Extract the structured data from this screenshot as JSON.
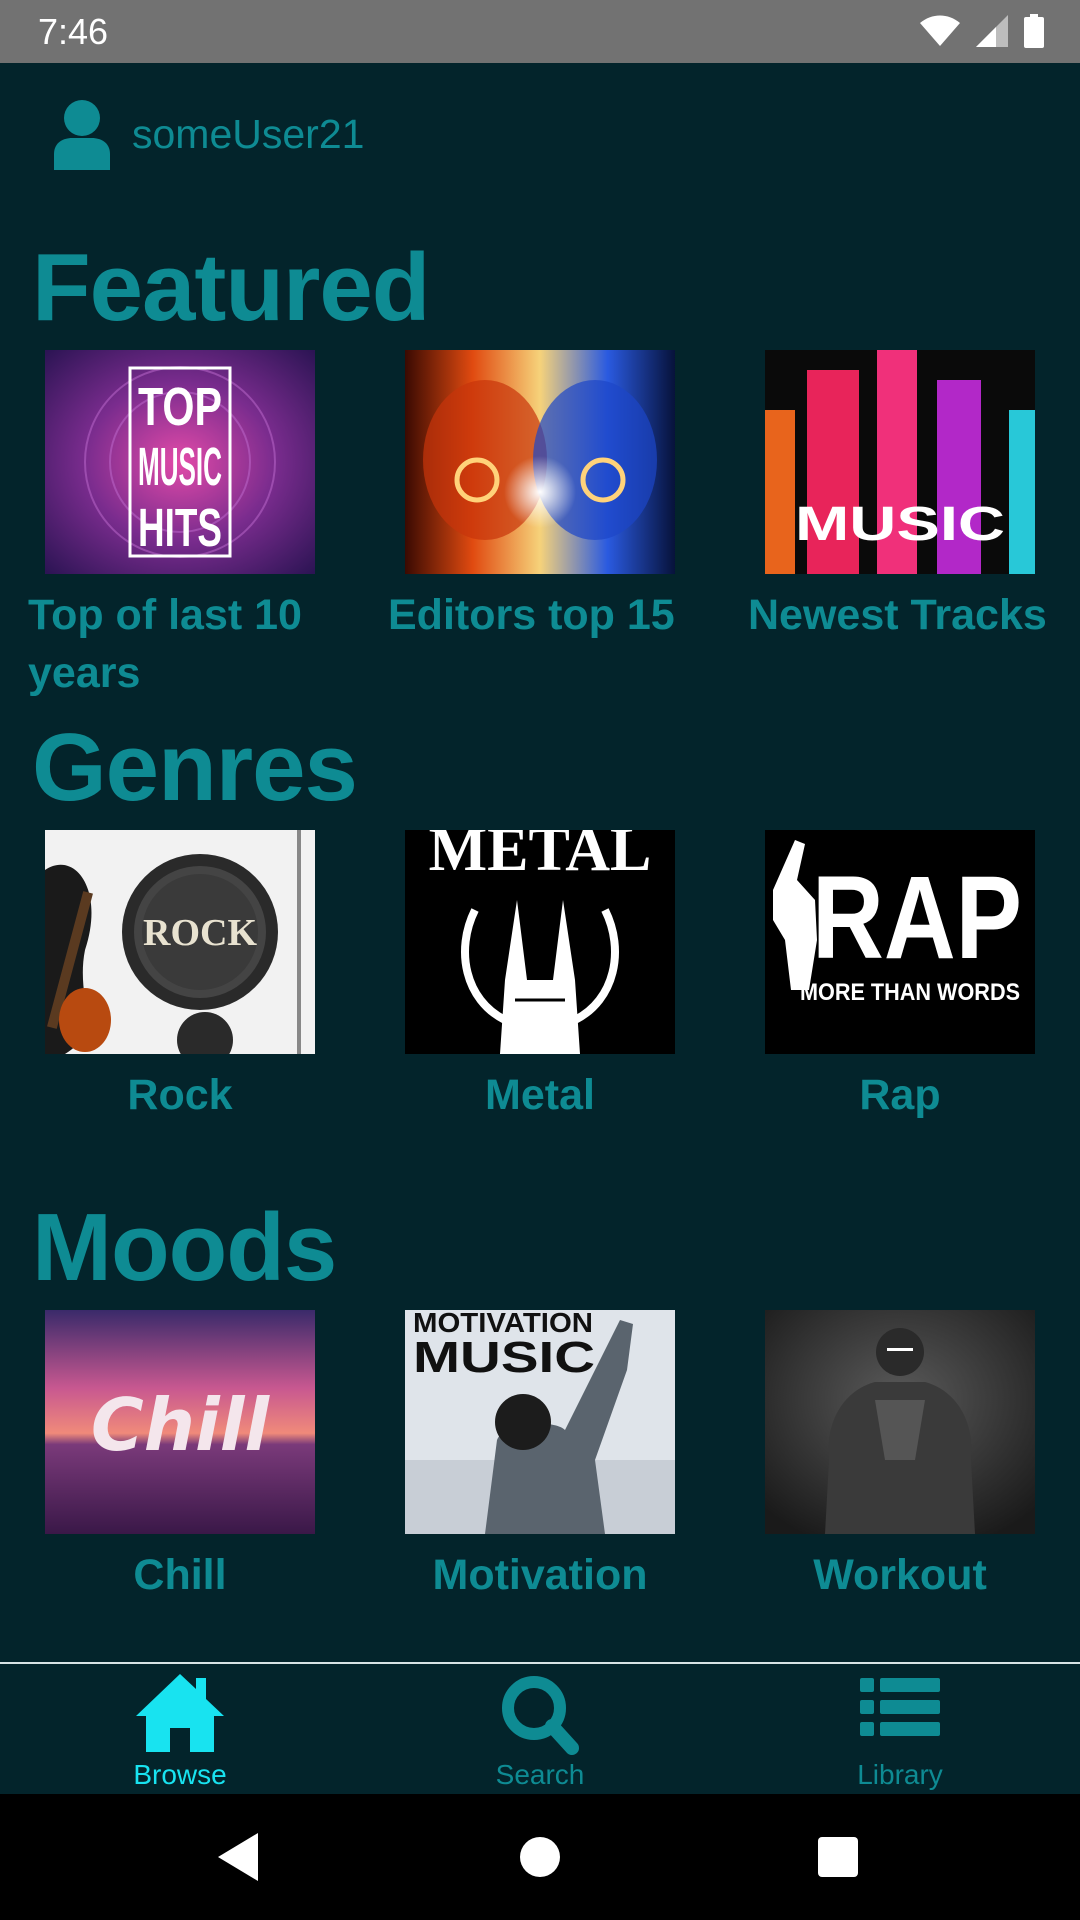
{
  "status_bar": {
    "time": "7:46",
    "icons": [
      "wifi-icon",
      "signal-icon",
      "battery-icon"
    ]
  },
  "user": {
    "icon": "person-icon",
    "username": "someUser21"
  },
  "sections": {
    "featured": {
      "title": "Featured",
      "items": [
        {
          "label": "Top of last 10 years",
          "art_text": [
            "TOP",
            "MUSIC",
            "HITS"
          ]
        },
        {
          "label": "Editors top 15"
        },
        {
          "label": "Newest Tracks",
          "art_text": "MUSIC"
        }
      ]
    },
    "genres": {
      "title": "Genres",
      "items": [
        {
          "label": "Rock",
          "art_text": "ROCK"
        },
        {
          "label": "Metal",
          "art_text": "METAL"
        },
        {
          "label": "Rap",
          "art_text": "RAP",
          "art_subtext": "MORE THAN WORDS"
        }
      ]
    },
    "moods": {
      "title": "Moods",
      "items": [
        {
          "label": "Chill",
          "art_text": "Chill"
        },
        {
          "label": "Motivation",
          "art_text": [
            "MOTIVATION",
            "MUSIC"
          ]
        },
        {
          "label": "Workout"
        }
      ]
    }
  },
  "bottom_nav": {
    "items": [
      {
        "label": "Browse",
        "icon": "home-icon",
        "active": true
      },
      {
        "label": "Search",
        "icon": "search-icon",
        "active": false
      },
      {
        "label": "Library",
        "icon": "list-icon",
        "active": false
      }
    ]
  },
  "system_nav": [
    "back-icon",
    "home-circle-icon",
    "recents-icon"
  ],
  "colors": {
    "background": "#03242b",
    "accent": "#0e8b93",
    "active_nav": "#18e3f0",
    "status_bar": "#727272"
  }
}
